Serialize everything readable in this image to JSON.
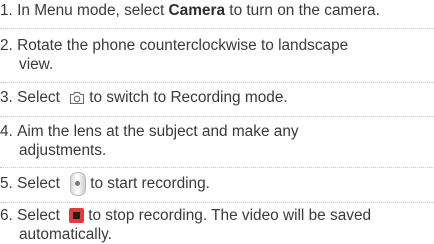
{
  "steps": [
    {
      "num": "1.",
      "pre": "In Menu mode, select ",
      "bold": "Camera",
      "post": " to turn on the camera."
    },
    {
      "num": "2.",
      "line1": "Rotate the phone counterclockwise to landscape",
      "line2": "view."
    },
    {
      "num": "3.",
      "pre": "Select ",
      "icon": "camera-switch-icon",
      "post": "to switch to Recording mode."
    },
    {
      "num": "4.",
      "line1": "Aim the lens at the subject and make any",
      "line2": "adjustments."
    },
    {
      "num": "5.",
      "pre": "Select ",
      "icon": "record-button-icon",
      "post": "to start recording."
    },
    {
      "num": "6.",
      "pre": "Select ",
      "icon": "stop-button-icon",
      "post": "to stop recording. The video will be saved",
      "line2": "automatically."
    }
  ],
  "colors": {
    "text": "#3a3a3a",
    "separator": "#c8c8c8",
    "stop_red": "#e53a3a"
  }
}
